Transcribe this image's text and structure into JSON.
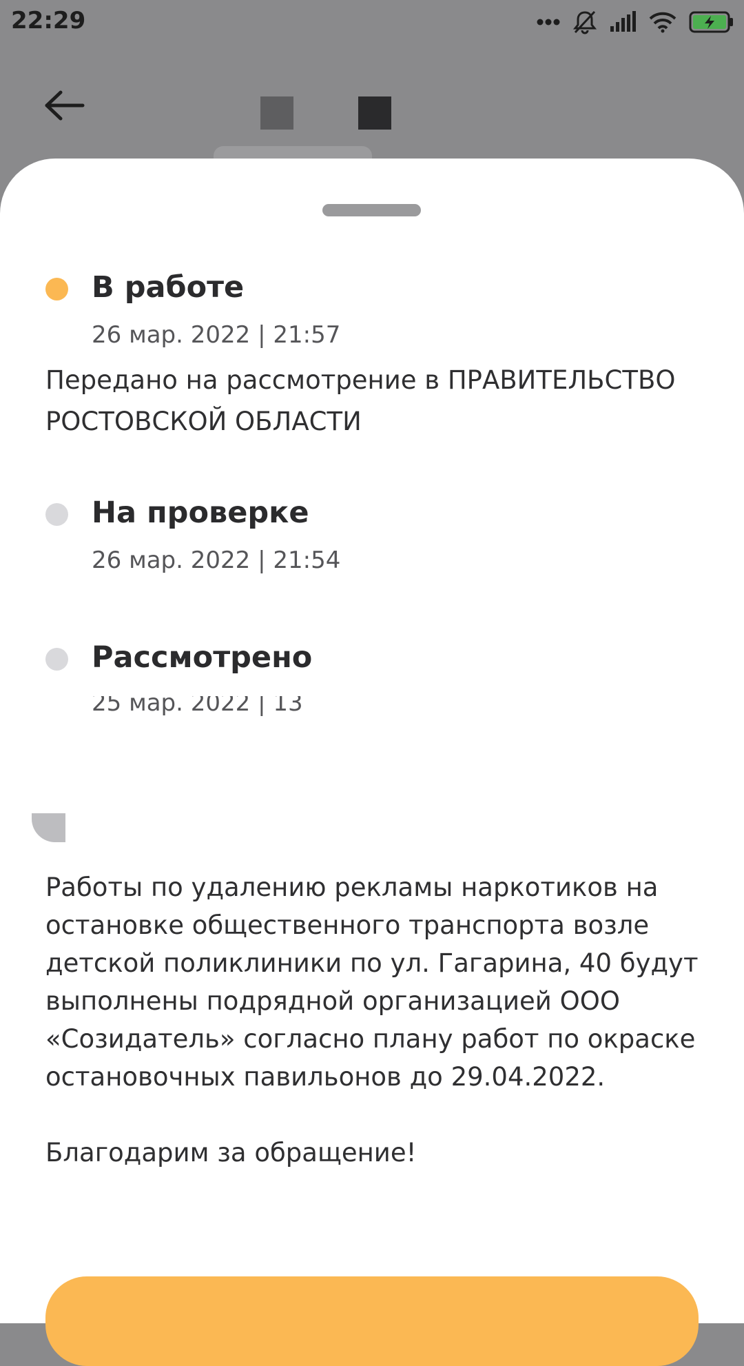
{
  "status_bar": {
    "time": "22:29",
    "icons": [
      "more-dots-icon",
      "bell-muted-icon",
      "signal-icon",
      "wifi-icon",
      "battery-charging-icon"
    ]
  },
  "header": {
    "back_icon": "arrow-left-icon"
  },
  "timeline": [
    {
      "title": "В работе",
      "date": "26 мар. 2022 | 21:57",
      "description": "Передано на рассмотрение в ПРАВИТЕЛЬСТВО РОСТОВСКОЙ ОБЛАСТИ",
      "status_color": "#fbb853"
    },
    {
      "title": "На проверке",
      "date": "26 мар. 2022 | 21:54",
      "status_color": "#d9d9dc"
    },
    {
      "title": "Рассмотрено",
      "date": "25 мар. 2022 | 13",
      "status_color": "#d9d9dc"
    }
  ],
  "response": {
    "text": "Работы по удалению рекламы наркотиков на остановке общественного транспорта возле детской поликлиники по ул. Гагарина, 40 будут выполнены подрядной организацией ООО «Созидатель» согласно плану работ по окраске остановочных павильонов до 29.04.2022.\n\nБлагодарим за обращение!"
  },
  "accent_color": "#fbb853"
}
